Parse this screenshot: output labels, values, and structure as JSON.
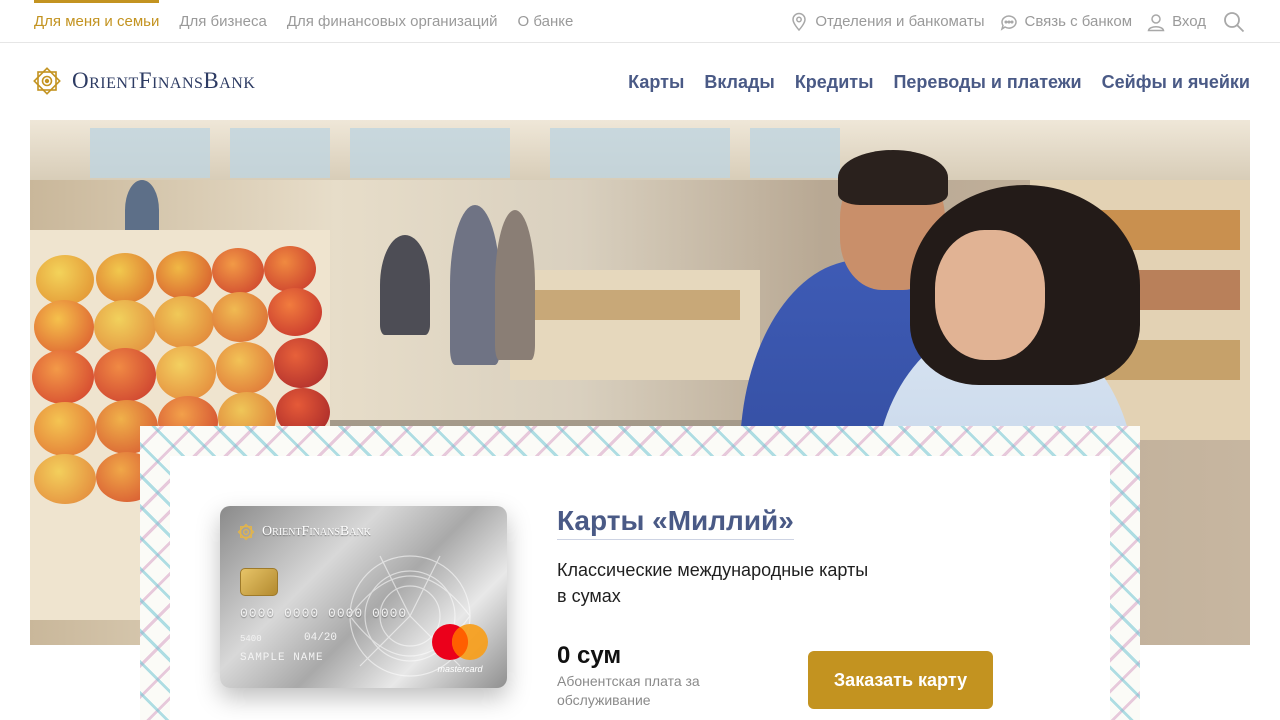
{
  "segments": [
    {
      "label": "Для меня и семьи",
      "active": true
    },
    {
      "label": "Для бизнеса",
      "active": false
    },
    {
      "label": "Для финансовых организаций",
      "active": false
    },
    {
      "label": "О банке",
      "active": false
    }
  ],
  "utility": {
    "branches_label": "Отделения и банкоматы",
    "contact_label": "Связь с банком",
    "login_label": "Вход"
  },
  "brand": {
    "name": "OrientFinansBank"
  },
  "main_nav": [
    "Карты",
    "Вклады",
    "Кредиты",
    "Переводы и платежи",
    "Сейфы и ячейки"
  ],
  "card_image": {
    "brand": "OrientFinansBank",
    "number": "0000 0000 0000 0000",
    "valid_label": "5400",
    "expiry": "04/20",
    "holder": "SAMPLE NAME",
    "network": "mastercard"
  },
  "product": {
    "title": "Карты «Миллий»",
    "description_line1": "Классические международные карты",
    "description_line2": "в сумах",
    "price": "0 сум",
    "price_note": "Абонентская плата за обслуживание",
    "order_label": "Заказать карту"
  },
  "colors": {
    "accent": "#c39320",
    "nav_text": "#4a5a86",
    "muted": "#9a9a9a"
  }
}
